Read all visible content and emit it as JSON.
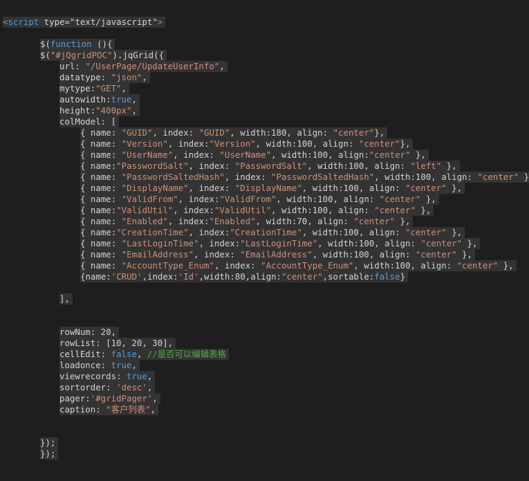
{
  "code_lines": [
    {
      "indent": 0,
      "hl": true,
      "tokens": [
        {
          "t": "<script",
          "c": "tag"
        },
        {
          "t": " type",
          "c": "pn"
        },
        {
          "t": "=",
          "c": "pn"
        },
        {
          "t": "\"text/javascript\"",
          "c": "pn"
        },
        {
          "t": ">",
          "c": "tag"
        }
      ]
    },
    {
      "indent": 0,
      "hl": false,
      "tokens": []
    },
    {
      "indent": 1,
      "hl": true,
      "tokens": [
        {
          "t": "$(",
          "c": "pn"
        },
        {
          "t": "function",
          "c": "kw"
        },
        {
          "t": " (){",
          "c": "pn"
        }
      ]
    },
    {
      "indent": 1,
      "hl": true,
      "tokens": [
        {
          "t": "$(",
          "c": "pn"
        },
        {
          "t": "\"#jQgridPOC\"",
          "c": "str"
        },
        {
          "t": ").jqGrid({",
          "c": "pn"
        }
      ]
    },
    {
      "indent": 2,
      "hl": true,
      "tokens": [
        {
          "t": "url: ",
          "c": "pn"
        },
        {
          "t": "\"/UserPage/UpdateUserInfo\"",
          "c": "str"
        },
        {
          "t": ",",
          "c": "pn"
        }
      ]
    },
    {
      "indent": 2,
      "hl": true,
      "tokens": [
        {
          "t": "datatype: ",
          "c": "pn"
        },
        {
          "t": "\"json\"",
          "c": "str"
        },
        {
          "t": ",",
          "c": "pn"
        }
      ]
    },
    {
      "indent": 2,
      "hl": true,
      "tokens": [
        {
          "t": "mytype:",
          "c": "pn"
        },
        {
          "t": "\"GET\"",
          "c": "str"
        },
        {
          "t": ",",
          "c": "pn"
        }
      ]
    },
    {
      "indent": 2,
      "hl": true,
      "tokens": [
        {
          "t": "autowidth:",
          "c": "pn"
        },
        {
          "t": "true",
          "c": "kw"
        },
        {
          "t": ",",
          "c": "pn"
        }
      ]
    },
    {
      "indent": 2,
      "hl": true,
      "tokens": [
        {
          "t": "height:",
          "c": "pn"
        },
        {
          "t": "\"400px\"",
          "c": "str"
        },
        {
          "t": ",",
          "c": "pn"
        }
      ]
    },
    {
      "indent": 2,
      "hl": true,
      "tokens": [
        {
          "t": "colModel: [",
          "c": "pn"
        }
      ]
    },
    {
      "indent": 3,
      "hl": true,
      "tokens": [
        {
          "t": "{ name: ",
          "c": "pn"
        },
        {
          "t": "\"GUID\"",
          "c": "str"
        },
        {
          "t": ", index: ",
          "c": "pn"
        },
        {
          "t": "\"GUID\"",
          "c": "str"
        },
        {
          "t": ", width:180, align: ",
          "c": "pn"
        },
        {
          "t": "\"center\"",
          "c": "str"
        },
        {
          "t": "},",
          "c": "pn"
        }
      ]
    },
    {
      "indent": 3,
      "hl": true,
      "tokens": [
        {
          "t": "{ name: ",
          "c": "pn"
        },
        {
          "t": "\"Version\"",
          "c": "str"
        },
        {
          "t": ", index:",
          "c": "pn"
        },
        {
          "t": "\"Version\"",
          "c": "str"
        },
        {
          "t": ", width:100, align: ",
          "c": "pn"
        },
        {
          "t": "\"center\"",
          "c": "str"
        },
        {
          "t": "},",
          "c": "pn"
        }
      ]
    },
    {
      "indent": 3,
      "hl": true,
      "tokens": [
        {
          "t": "{ name: ",
          "c": "pn"
        },
        {
          "t": "\"UserName\"",
          "c": "str"
        },
        {
          "t": ", index: ",
          "c": "pn"
        },
        {
          "t": "\"UserName\"",
          "c": "str"
        },
        {
          "t": ", width:100, align:",
          "c": "pn"
        },
        {
          "t": "\"center\"",
          "c": "str"
        },
        {
          "t": " },",
          "c": "pn"
        }
      ]
    },
    {
      "indent": 3,
      "hl": true,
      "tokens": [
        {
          "t": "{ name:",
          "c": "pn"
        },
        {
          "t": "\"PasswordSalt\"",
          "c": "str"
        },
        {
          "t": ", index: ",
          "c": "pn"
        },
        {
          "t": "\"PasswordSalt\"",
          "c": "str"
        },
        {
          "t": ", width:100, align: ",
          "c": "pn"
        },
        {
          "t": "\"left\"",
          "c": "str"
        },
        {
          "t": " },",
          "c": "pn"
        }
      ]
    },
    {
      "indent": 3,
      "hl": true,
      "tokens": [
        {
          "t": "{ name: ",
          "c": "pn"
        },
        {
          "t": "\"PasswordSaltedHash\"",
          "c": "str"
        },
        {
          "t": ", index: ",
          "c": "pn"
        },
        {
          "t": "\"PasswordSaltedHash\"",
          "c": "str"
        },
        {
          "t": ", width:100, align: ",
          "c": "pn"
        },
        {
          "t": "\"center\"",
          "c": "str"
        },
        {
          "t": " },",
          "c": "pn"
        }
      ]
    },
    {
      "indent": 3,
      "hl": true,
      "tokens": [
        {
          "t": "{ name: ",
          "c": "pn"
        },
        {
          "t": "\"DisplayName\"",
          "c": "str"
        },
        {
          "t": ", index: ",
          "c": "pn"
        },
        {
          "t": "\"DisplayName\"",
          "c": "str"
        },
        {
          "t": ", width:100, align: ",
          "c": "pn"
        },
        {
          "t": "\"center\"",
          "c": "str"
        },
        {
          "t": " },",
          "c": "pn"
        }
      ]
    },
    {
      "indent": 3,
      "hl": true,
      "tokens": [
        {
          "t": "{ name: ",
          "c": "pn"
        },
        {
          "t": "\"ValidFrom\"",
          "c": "str"
        },
        {
          "t": ", index:",
          "c": "pn"
        },
        {
          "t": "\"ValidFrom\"",
          "c": "str"
        },
        {
          "t": ", width:100, align: ",
          "c": "pn"
        },
        {
          "t": "\"center\"",
          "c": "str"
        },
        {
          "t": " },",
          "c": "pn"
        }
      ]
    },
    {
      "indent": 3,
      "hl": true,
      "tokens": [
        {
          "t": "{ name:",
          "c": "pn"
        },
        {
          "t": "\"ValidUtil\"",
          "c": "str"
        },
        {
          "t": ", index:",
          "c": "pn"
        },
        {
          "t": "\"ValidUtil\"",
          "c": "str"
        },
        {
          "t": ", width:100, align: ",
          "c": "pn"
        },
        {
          "t": "\"center\"",
          "c": "str"
        },
        {
          "t": " },",
          "c": "pn"
        }
      ]
    },
    {
      "indent": 3,
      "hl": true,
      "tokens": [
        {
          "t": "{ name: ",
          "c": "pn"
        },
        {
          "t": "\"Enabled\"",
          "c": "str"
        },
        {
          "t": ", index:",
          "c": "pn"
        },
        {
          "t": "\"Enabled\"",
          "c": "str"
        },
        {
          "t": ", width:70, align: ",
          "c": "pn"
        },
        {
          "t": "\"center\"",
          "c": "str"
        },
        {
          "t": " },",
          "c": "pn"
        }
      ]
    },
    {
      "indent": 3,
      "hl": true,
      "tokens": [
        {
          "t": "{ name:",
          "c": "pn"
        },
        {
          "t": "\"CreationTime\"",
          "c": "str"
        },
        {
          "t": ", index:",
          "c": "pn"
        },
        {
          "t": "\"CreationTime\"",
          "c": "str"
        },
        {
          "t": ", width:100, align: ",
          "c": "pn"
        },
        {
          "t": "\"center\"",
          "c": "str"
        },
        {
          "t": " },",
          "c": "pn"
        }
      ]
    },
    {
      "indent": 3,
      "hl": true,
      "tokens": [
        {
          "t": "{ name: ",
          "c": "pn"
        },
        {
          "t": "\"LastLoginTime\"",
          "c": "str"
        },
        {
          "t": ", index:",
          "c": "pn"
        },
        {
          "t": "\"LastLoginTime\"",
          "c": "str"
        },
        {
          "t": ", width:100, align: ",
          "c": "pn"
        },
        {
          "t": "\"center\"",
          "c": "str"
        },
        {
          "t": " },",
          "c": "pn"
        }
      ]
    },
    {
      "indent": 3,
      "hl": true,
      "tokens": [
        {
          "t": "{ name: ",
          "c": "pn"
        },
        {
          "t": "\"EmailAddress\"",
          "c": "str"
        },
        {
          "t": ", index: ",
          "c": "pn"
        },
        {
          "t": "\"EmailAddress\"",
          "c": "str"
        },
        {
          "t": ", width:100, align: ",
          "c": "pn"
        },
        {
          "t": "\"center\"",
          "c": "str"
        },
        {
          "t": " },",
          "c": "pn"
        }
      ]
    },
    {
      "indent": 3,
      "hl": true,
      "tokens": [
        {
          "t": "{ name: ",
          "c": "pn"
        },
        {
          "t": "\"AccountType_Enum\"",
          "c": "str"
        },
        {
          "t": ", index: ",
          "c": "pn"
        },
        {
          "t": "\"AccountType_Enum\"",
          "c": "str"
        },
        {
          "t": ", width:100, align: ",
          "c": "pn"
        },
        {
          "t": "\"center\"",
          "c": "str"
        },
        {
          "t": " },",
          "c": "pn"
        }
      ]
    },
    {
      "indent": 3,
      "hl": true,
      "tokens": [
        {
          "t": "{name:",
          "c": "pn"
        },
        {
          "t": "'CRUD'",
          "c": "str"
        },
        {
          "t": ",index:",
          "c": "pn"
        },
        {
          "t": "'Id'",
          "c": "str"
        },
        {
          "t": ",width:80,align:",
          "c": "pn"
        },
        {
          "t": "\"center\"",
          "c": "str"
        },
        {
          "t": ",sortable:",
          "c": "pn"
        },
        {
          "t": "false",
          "c": "kw"
        },
        {
          "t": "}",
          "c": "pn"
        }
      ]
    },
    {
      "indent": 0,
      "hl": true,
      "tokens": []
    },
    {
      "indent": 2,
      "hl": true,
      "tokens": [
        {
          "t": "],",
          "c": "pn"
        }
      ]
    },
    {
      "indent": 0,
      "hl": false,
      "tokens": []
    },
    {
      "indent": 0,
      "hl": true,
      "tokens": []
    },
    {
      "indent": 2,
      "hl": true,
      "tokens": [
        {
          "t": "rowNum: 20,",
          "c": "pn"
        }
      ]
    },
    {
      "indent": 2,
      "hl": true,
      "tokens": [
        {
          "t": "rowList: [10, 20, 30],",
          "c": "pn"
        }
      ]
    },
    {
      "indent": 2,
      "hl": true,
      "tokens": [
        {
          "t": "cellEdit: ",
          "c": "pn"
        },
        {
          "t": "false",
          "c": "kw"
        },
        {
          "t": ", ",
          "c": "pn"
        },
        {
          "t": "//是否可以编辑表格",
          "c": "com"
        }
      ]
    },
    {
      "indent": 2,
      "hl": true,
      "tokens": [
        {
          "t": "loadonce: ",
          "c": "pn"
        },
        {
          "t": "true",
          "c": "kw"
        },
        {
          "t": ",",
          "c": "pn"
        }
      ]
    },
    {
      "indent": 2,
      "hl": true,
      "tokens": [
        {
          "t": "viewrecords: ",
          "c": "pn"
        },
        {
          "t": "true",
          "c": "kw"
        },
        {
          "t": ",",
          "c": "pn"
        }
      ]
    },
    {
      "indent": 2,
      "hl": true,
      "tokens": [
        {
          "t": "sortorder: ",
          "c": "pn"
        },
        {
          "t": "'desc'",
          "c": "str"
        },
        {
          "t": ",",
          "c": "pn"
        }
      ]
    },
    {
      "indent": 2,
      "hl": true,
      "tokens": [
        {
          "t": "pager:",
          "c": "pn"
        },
        {
          "t": "'#gridPager'",
          "c": "str"
        },
        {
          "t": ",",
          "c": "pn"
        }
      ]
    },
    {
      "indent": 2,
      "hl": true,
      "tokens": [
        {
          "t": "caption: ",
          "c": "pn"
        },
        {
          "t": "\"客户列表\"",
          "c": "str"
        },
        {
          "t": ",",
          "c": "pn"
        }
      ]
    },
    {
      "indent": 0,
      "hl": true,
      "tokens": []
    },
    {
      "indent": 0,
      "hl": false,
      "tokens": []
    },
    {
      "indent": 1,
      "hl": true,
      "tokens": [
        {
          "t": "});",
          "c": "pn"
        }
      ]
    },
    {
      "indent": 1,
      "hl": true,
      "tokens": [
        {
          "t": "});",
          "c": "pn"
        }
      ]
    },
    {
      "indent": 0,
      "hl": true,
      "tokens": []
    }
  ],
  "colors": {
    "background": "#1e1e1e",
    "highlight": "#333333",
    "keyword": "#569cd6",
    "string": "#ce9178",
    "comment": "#57a64a",
    "plain": "#d4d4d4"
  }
}
